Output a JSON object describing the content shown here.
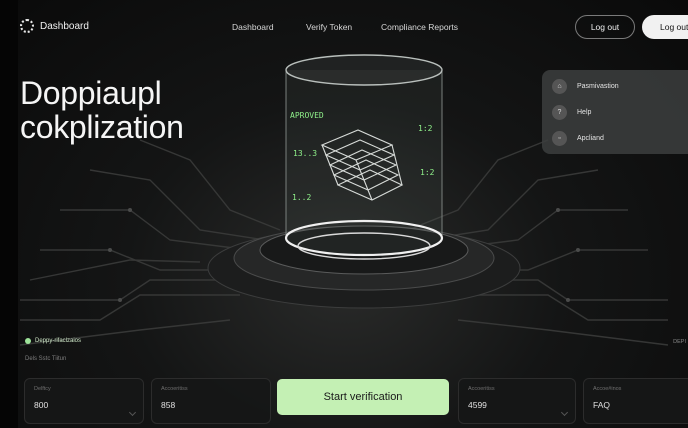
{
  "header": {
    "logo_text": "Dashboard",
    "nav": [
      "Dashboard",
      "Verify Token",
      "Compliance Reports"
    ],
    "logout_outline": "Log out",
    "logout_fill": "Log out"
  },
  "hero": {
    "line1": "Doppiaupl",
    "line2": "cokplization"
  },
  "dropdown": {
    "items": [
      {
        "label": "Pasmivastion",
        "icon": "home-icon"
      },
      {
        "label": "Help",
        "icon": "help-icon"
      },
      {
        "label": "Apcliand",
        "icon": "square-icon"
      }
    ]
  },
  "hologram": {
    "approved": "APROVED",
    "label_a": "13..3",
    "label_b": "1..2",
    "label_c": "1:2",
    "label_d": "1:2"
  },
  "status": {
    "title": "Deppy-rifaclzaios",
    "subtitle": "Dels Sstc Tiitun",
    "right_tag": "DEPI"
  },
  "cards": [
    {
      "label": "Delftcy",
      "value": "800"
    },
    {
      "label": "Accoeritiss",
      "value": "858"
    },
    {
      "label": "Accoeritiss",
      "value": "4599"
    },
    {
      "label": "Accoe#inos",
      "value": "FAQ"
    }
  ],
  "cta": {
    "label": "Start verification"
  },
  "colors": {
    "accent": "#c4f0b4",
    "holo_green": "#8ff08a",
    "bg": "#121313"
  }
}
